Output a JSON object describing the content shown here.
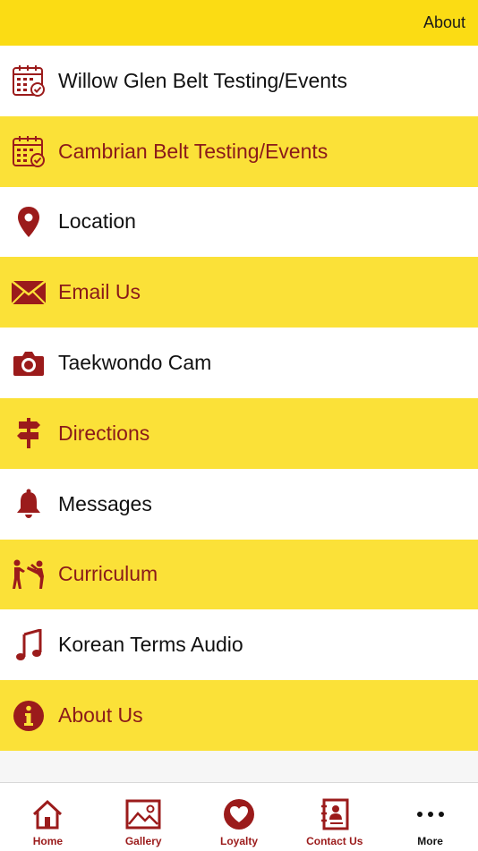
{
  "header": {
    "about_label": "About"
  },
  "menu": [
    {
      "label": "Willow Glen Belt Testing/Events",
      "icon": "calendar-check-icon"
    },
    {
      "label": "Cambrian Belt Testing/Events",
      "icon": "calendar-check-icon"
    },
    {
      "label": "Location",
      "icon": "map-pin-icon"
    },
    {
      "label": "Email Us",
      "icon": "envelope-icon"
    },
    {
      "label": "Taekwondo Cam",
      "icon": "camera-icon"
    },
    {
      "label": "Directions",
      "icon": "signpost-icon"
    },
    {
      "label": "Messages",
      "icon": "bell-icon"
    },
    {
      "label": "Curriculum",
      "icon": "martial-arts-kick-icon"
    },
    {
      "label": "Korean Terms Audio",
      "icon": "music-note-icon"
    },
    {
      "label": "About Us",
      "icon": "info-icon"
    }
  ],
  "tabs": [
    {
      "label": "Home",
      "icon": "home-icon"
    },
    {
      "label": "Gallery",
      "icon": "gallery-icon"
    },
    {
      "label": "Loyalty",
      "icon": "heart-icon"
    },
    {
      "label": "Contact Us",
      "icon": "contact-book-icon"
    },
    {
      "label": "More",
      "icon": "more-dots-icon"
    }
  ],
  "colors": {
    "accent_red": "#9b1b1b",
    "yellow": "#fbe138",
    "header_yellow": "#fbdc14"
  }
}
